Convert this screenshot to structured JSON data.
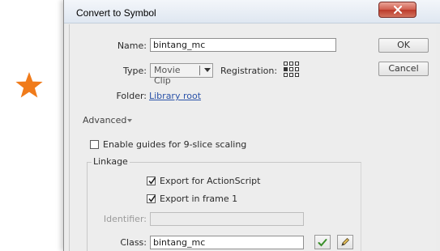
{
  "dialog": {
    "title": "Convert to Symbol",
    "close_icon": "close-x-icon"
  },
  "form": {
    "name_label": "Name:",
    "name_value": "bintang_mc",
    "type_label": "Type:",
    "type_value": "Movie Clip",
    "registration_label": "Registration:",
    "folder_label": "Folder:",
    "folder_link": "Library root",
    "advanced_label": "Advanced"
  },
  "buttons": {
    "ok": "OK",
    "cancel": "Cancel"
  },
  "options": {
    "nine_slice_label": "Enable guides for 9-slice scaling",
    "nine_slice_checked": false
  },
  "linkage": {
    "title": "Linkage",
    "export_actionscript_label": "Export for ActionScript",
    "export_actionscript_checked": true,
    "export_frame1_label": "Export in frame 1",
    "export_frame1_checked": true,
    "identifier_label": "Identifier:",
    "identifier_value": "",
    "class_label": "Class:",
    "class_value": "bintang_mc"
  },
  "colors": {
    "star": "#f07b1a",
    "close_button": "#c9473a",
    "link": "#2a52a8",
    "checkmark_green": "#3a8f2a"
  },
  "icons": {
    "stage": "star-icon",
    "validate": "checkmark-icon",
    "edit": "pencil-icon"
  }
}
